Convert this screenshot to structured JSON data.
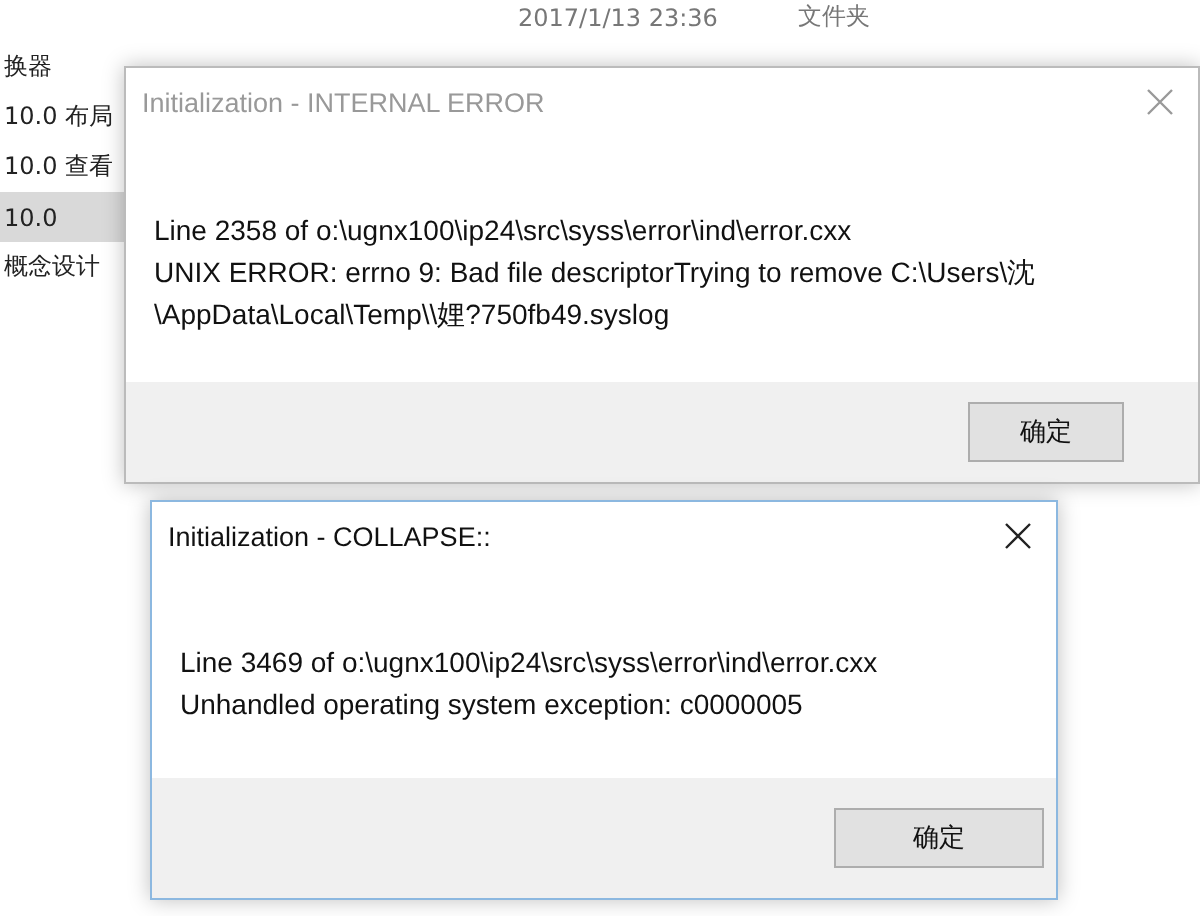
{
  "file_list": {
    "rows": [
      {
        "date": "2017/1/13 23:36",
        "type": "文件夹",
        "selected": false
      },
      {
        "name": "换器",
        "selected": false
      },
      {
        "name": "10.0 布局",
        "selected": false
      },
      {
        "name": "10.0 查看",
        "selected": false
      },
      {
        "name": "10.0",
        "selected": true
      },
      {
        "name": "概念设计",
        "selected": false
      }
    ]
  },
  "dialogs": [
    {
      "title": "Initialization - INTERNAL ERROR",
      "active": false,
      "lines": [
        "Line 2358 of o:\\ugnx100\\ip24\\src\\syss\\error\\ind\\error.cxx",
        "UNIX ERROR: errno 9: Bad file descriptorTrying to remove C:\\Users\\沈",
        "\\AppData\\Local\\Temp\\\\娌?750fb49.syslog"
      ],
      "button": "确定"
    },
    {
      "title": "Initialization - COLLAPSE::",
      "active": true,
      "lines": [
        "Line 3469 of o:\\ugnx100\\ip24\\src\\syss\\error\\ind\\error.cxx",
        "Unhandled operating system exception: c0000005"
      ],
      "button": "确定"
    }
  ]
}
